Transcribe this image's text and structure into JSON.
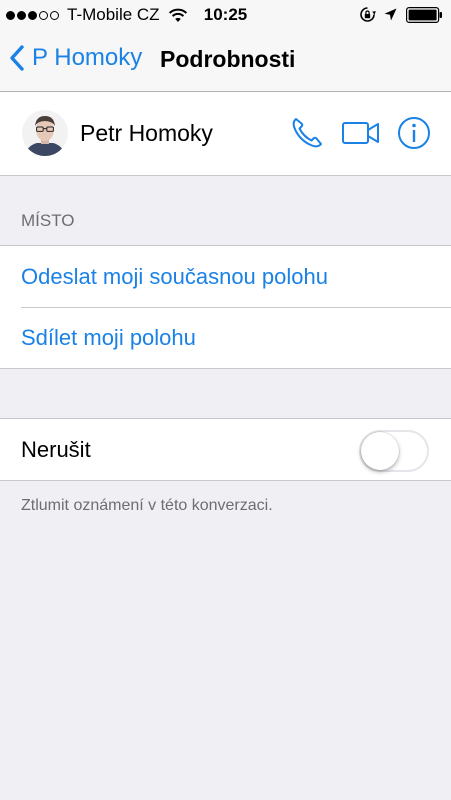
{
  "status_bar": {
    "carrier": "T-Mobile CZ",
    "time": "10:25",
    "signal_bars_filled": 3,
    "signal_bars_total": 5
  },
  "nav": {
    "back_label": "P Homoky",
    "title": "Podrobnosti"
  },
  "contact": {
    "name": "Petr Homoky",
    "actions": [
      "phone-icon",
      "video-camera-icon",
      "info-icon"
    ]
  },
  "location_section": {
    "header": "MÍSTO",
    "items": [
      "Odeslat moji současnou polohu",
      "Sdílet moji polohu"
    ]
  },
  "do_not_disturb": {
    "label": "Nerušit",
    "enabled": false,
    "footer": "Ztlumit oznámení v této konverzaci."
  },
  "colors": {
    "accent": "#1a82e6",
    "background": "#efeff4",
    "secondary_text": "#6d6d72"
  }
}
